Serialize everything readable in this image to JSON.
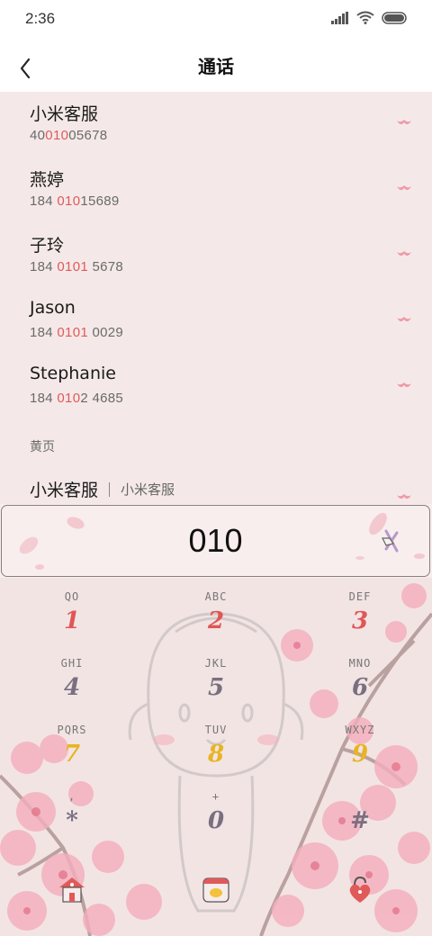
{
  "status_bar": {
    "time": "2:36"
  },
  "header": {
    "title": "通话"
  },
  "contacts": [
    {
      "name": "小米客服",
      "num_pre": "40",
      "num_hl": "010",
      "num_post": "05678"
    },
    {
      "name": "燕婷",
      "num_pre": "184 ",
      "num_hl": "010",
      "num_post": "15689"
    },
    {
      "name": "子玲",
      "num_pre": "184 ",
      "num_hl": "0101",
      "num_post": " 5678"
    },
    {
      "name": "Jason",
      "num_pre": "184 ",
      "num_hl": "0101",
      "num_post": " 0029"
    },
    {
      "name": "Stephanie",
      "num_pre": "184 ",
      "num_hl": "010",
      "num_post": "2 4685"
    }
  ],
  "yellow_pages": {
    "section_label": "黄页",
    "name": "小米客服",
    "subtitle": "小米客服"
  },
  "dial_input": {
    "value": "010"
  },
  "keypad": [
    {
      "digit": "1",
      "letters": "QO",
      "color": "red"
    },
    {
      "digit": "2",
      "letters": "ABC",
      "color": "red"
    },
    {
      "digit": "3",
      "letters": "DEF",
      "color": "red"
    },
    {
      "digit": "4",
      "letters": "GHI",
      "color": "gray"
    },
    {
      "digit": "5",
      "letters": "JKL",
      "color": "gray"
    },
    {
      "digit": "6",
      "letters": "MNO",
      "color": "gray"
    },
    {
      "digit": "7",
      "letters": "PQRS",
      "color": "gold"
    },
    {
      "digit": "8",
      "letters": "TUV",
      "color": "gold"
    },
    {
      "digit": "9",
      "letters": "WXYZ",
      "color": "gold"
    },
    {
      "digit": "*",
      "letters": ",",
      "color": "gray"
    },
    {
      "digit": "0",
      "letters": "+",
      "color": "gray"
    },
    {
      "digit": "#",
      "letters": "",
      "color": "gray"
    }
  ],
  "colors": {
    "accent_red": "#e05a5a",
    "digit_gray": "#7a6f80",
    "digit_gold": "#e8b423",
    "petal_pink": "#f2a7b6"
  },
  "icons": {
    "back": "chevron-left-icon",
    "backspace": "backspace-icon",
    "left_action": "house-icon",
    "center_action": "call-icon",
    "right_action": "heart-lock-icon"
  }
}
